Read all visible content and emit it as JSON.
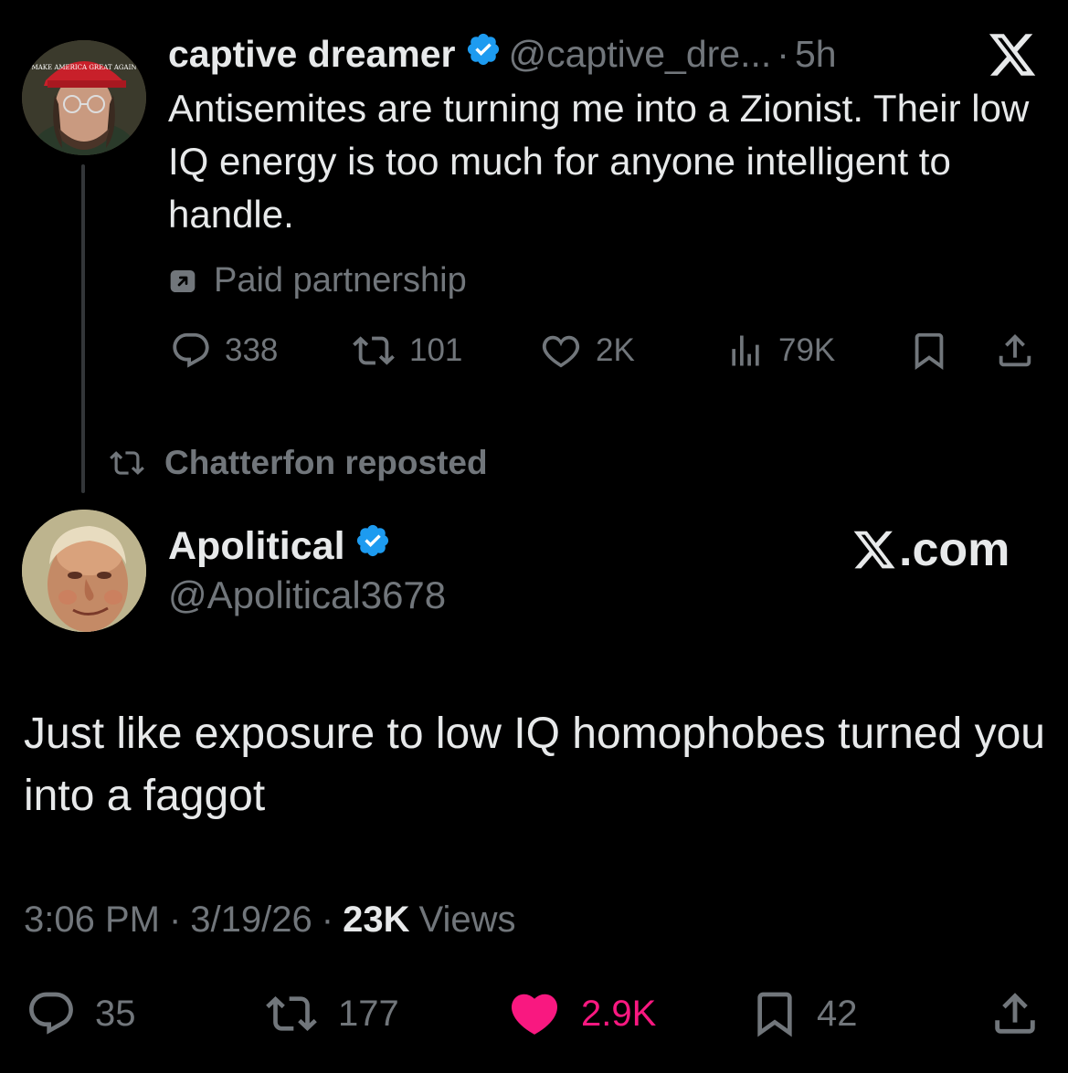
{
  "parent_tweet": {
    "author_name": "captive dreamer",
    "handle": "@captive_dre...",
    "separator": "·",
    "time": "5h",
    "text": "Antisemites are turning me into a Zionist. Their low IQ energy is too much for anyone intelligent to handle.",
    "paid_label": "Paid partnership",
    "actions": {
      "replies": "338",
      "reposts": "101",
      "likes": "2K",
      "views": "79K"
    },
    "avatar_hat_text": "MAKE AMERICA GREAT AGAIN"
  },
  "repost_banner": "Chatterfon reposted",
  "main_tweet": {
    "author_name": "Apolitical",
    "handle": "@Apolitical3678",
    "brand": ".com",
    "text": "Just like exposure to low IQ homophobes turned you into a faggot",
    "time": "3:06 PM",
    "date": "3/19/26",
    "views_count": "23K",
    "views_label": "Views",
    "dot": "·",
    "actions": {
      "replies": "35",
      "reposts": "177",
      "likes": "2.9K",
      "bookmarks": "42"
    }
  },
  "colors": {
    "background": "#000000",
    "text": "#e7e9ea",
    "muted": "#71767b",
    "verified": "#1d9bf0",
    "like_active": "#f91880"
  },
  "icons": [
    "x-logo-icon",
    "verified-badge-icon",
    "reply-icon",
    "repost-icon",
    "heart-icon",
    "views-icon",
    "bookmark-icon",
    "share-icon",
    "paid-partnership-icon"
  ]
}
